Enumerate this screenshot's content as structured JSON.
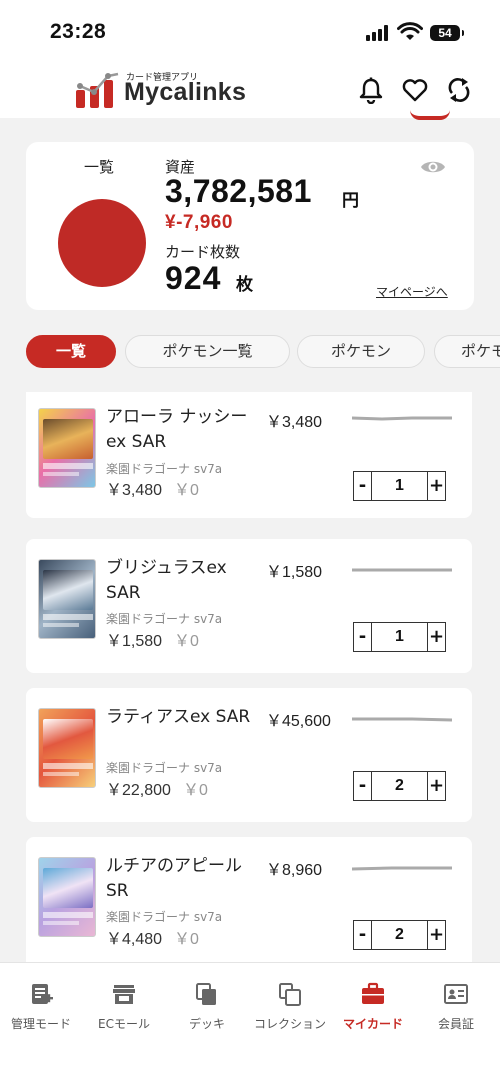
{
  "status_bar": {
    "time": "23:28",
    "battery": "54"
  },
  "header": {
    "logo_sub": "カード管理アプリ",
    "logo_name": "Mycalinks"
  },
  "summary": {
    "list_label": "一覧",
    "assets_label": "資産",
    "assets_value": "3,782,581",
    "assets_unit": "円",
    "diff": "¥-7,960",
    "count_label": "カード枚数",
    "count_value": "924",
    "count_unit": "枚",
    "mypage_link": "マイページへ",
    "accent_color": "#c62a24"
  },
  "tabs": [
    "一覧",
    "ポケモン一覧",
    "ポケモン",
    "ポケモ"
  ],
  "cards": [
    {
      "name": "アローラ ナッシーex SAR",
      "price": "￥3,480",
      "set": "楽園ドラゴーナ sv7a",
      "total": "￥3,480",
      "diff": "￥0",
      "quantity": "1"
    },
    {
      "name": "ブリジュラスex SAR",
      "price": "￥1,580",
      "set": "楽園ドラゴーナ sv7a",
      "total": "￥1,580",
      "diff": "￥0",
      "quantity": "1"
    },
    {
      "name": "ラティアスex SAR",
      "price": "￥45,600",
      "set": "楽園ドラゴーナ sv7a",
      "total": "￥22,800",
      "diff": "￥0",
      "quantity": "2"
    },
    {
      "name": "ルチアのアピール SR",
      "price": "￥8,960",
      "set": "楽園ドラゴーナ sv7a",
      "total": "￥4,480",
      "diff": "￥0",
      "quantity": "2"
    }
  ],
  "stepper": {
    "minus": "-",
    "plus": "+"
  },
  "bottom_nav": [
    {
      "label": "管理モード",
      "icon": "manage-icon"
    },
    {
      "label": "ECモール",
      "icon": "store-icon"
    },
    {
      "label": "デッキ",
      "icon": "deck-icon"
    },
    {
      "label": "コレクション",
      "icon": "collection-icon"
    },
    {
      "label": "マイカード",
      "icon": "briefcase-icon",
      "active": true
    },
    {
      "label": "会員証",
      "icon": "member-card-icon"
    }
  ]
}
